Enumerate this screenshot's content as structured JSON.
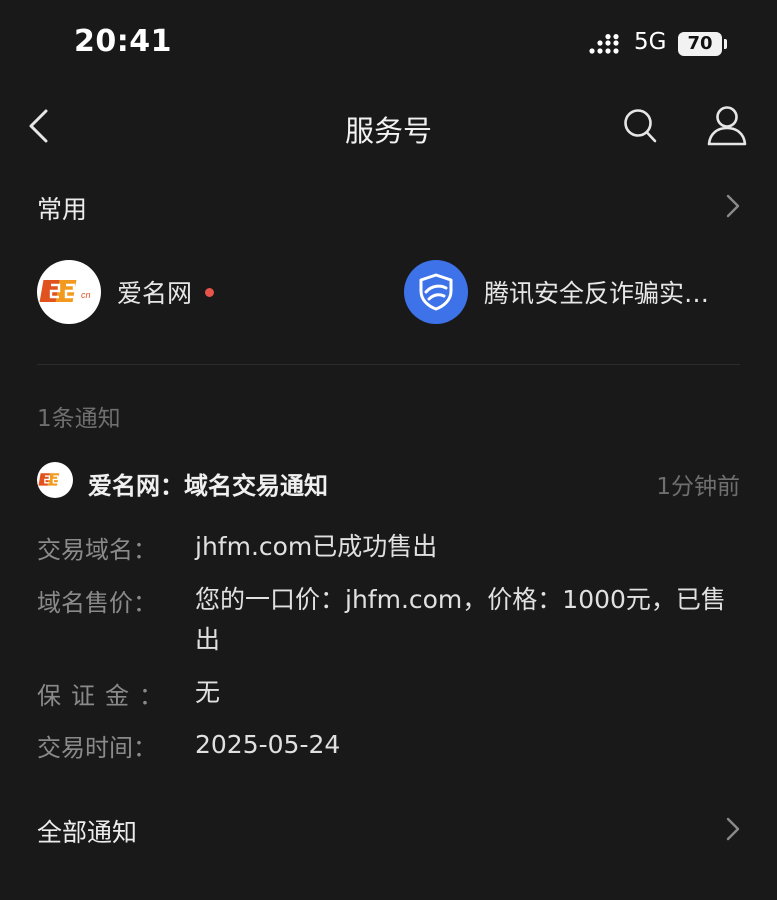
{
  "status_bar": {
    "time": "20:41",
    "network": "5G",
    "battery": "70"
  },
  "nav": {
    "title": "服务号"
  },
  "common": {
    "title": "常用",
    "accounts": [
      {
        "name": "爱名网",
        "icon": "22cn-logo",
        "has_unread": true
      },
      {
        "name": "腾讯安全反诈骗实…",
        "icon": "tencent-shield-logo",
        "has_unread": false
      }
    ]
  },
  "notification_count": "1条通知",
  "notification": {
    "title": "爱名网：域名交易通知",
    "time": "1分钟前",
    "fields": [
      {
        "label": "交易域名：",
        "value": "jhfm.com已成功售出"
      },
      {
        "label": "域名售价：",
        "value": "您的一口价：jhfm.com，价格：1000元，已售出"
      },
      {
        "label": "保证金：",
        "value": "无"
      },
      {
        "label": "交易时间：",
        "value": "2025-05-24"
      }
    ]
  },
  "all_notifications": "全部通知",
  "colors": {
    "background": "#191919",
    "unread_dot": "#e8534a",
    "tencent_blue": "#3d72e8",
    "aiming_orange": "#e0531f"
  }
}
